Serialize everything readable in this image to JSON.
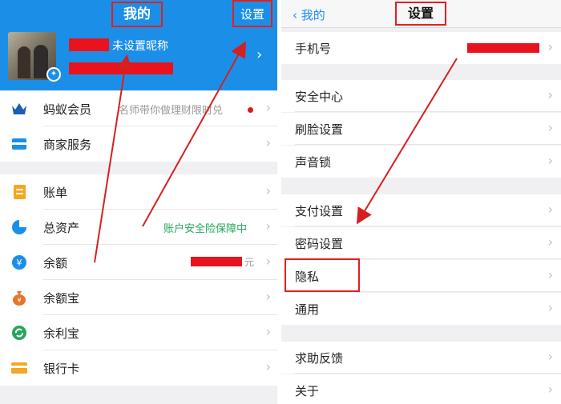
{
  "left": {
    "title": "我的",
    "settings": "设置",
    "nickname": "未设置昵称",
    "items": [
      {
        "icon": "crown-icon",
        "label": "蚂蚁会员",
        "note": "名师带你做理财限时兑",
        "note_color": "#999999",
        "red_dot": true
      },
      {
        "icon": "store-icon",
        "label": "商家服务",
        "note": ""
      },
      {
        "icon": "bill-icon",
        "label": "账单",
        "note": ""
      },
      {
        "icon": "pie-chart-icon",
        "label": "总资产",
        "note": "账户安全险保障中",
        "note_color": "#26a65b"
      },
      {
        "icon": "yen-icon",
        "label": "余额",
        "note": "元",
        "note_color": "#999999"
      },
      {
        "icon": "money-bag-icon",
        "label": "余额宝",
        "note": ""
      },
      {
        "icon": "refresh-icon",
        "label": "余利宝",
        "note": ""
      },
      {
        "icon": "bank-card-icon",
        "label": "银行卡",
        "note": ""
      }
    ]
  },
  "right": {
    "back": "我的",
    "title": "设置",
    "items": [
      {
        "label": "手机号"
      },
      {
        "label": "安全中心"
      },
      {
        "label": "刷脸设置"
      },
      {
        "label": "声音锁"
      },
      {
        "label": "支付设置"
      },
      {
        "label": "密码设置"
      },
      {
        "label": "隐私"
      },
      {
        "label": "通用"
      },
      {
        "label": "求助反馈"
      },
      {
        "label": "关于"
      }
    ]
  },
  "colors": {
    "brand": "#1b8fe8",
    "highlight": "#e02020",
    "green": "#26a65b"
  }
}
